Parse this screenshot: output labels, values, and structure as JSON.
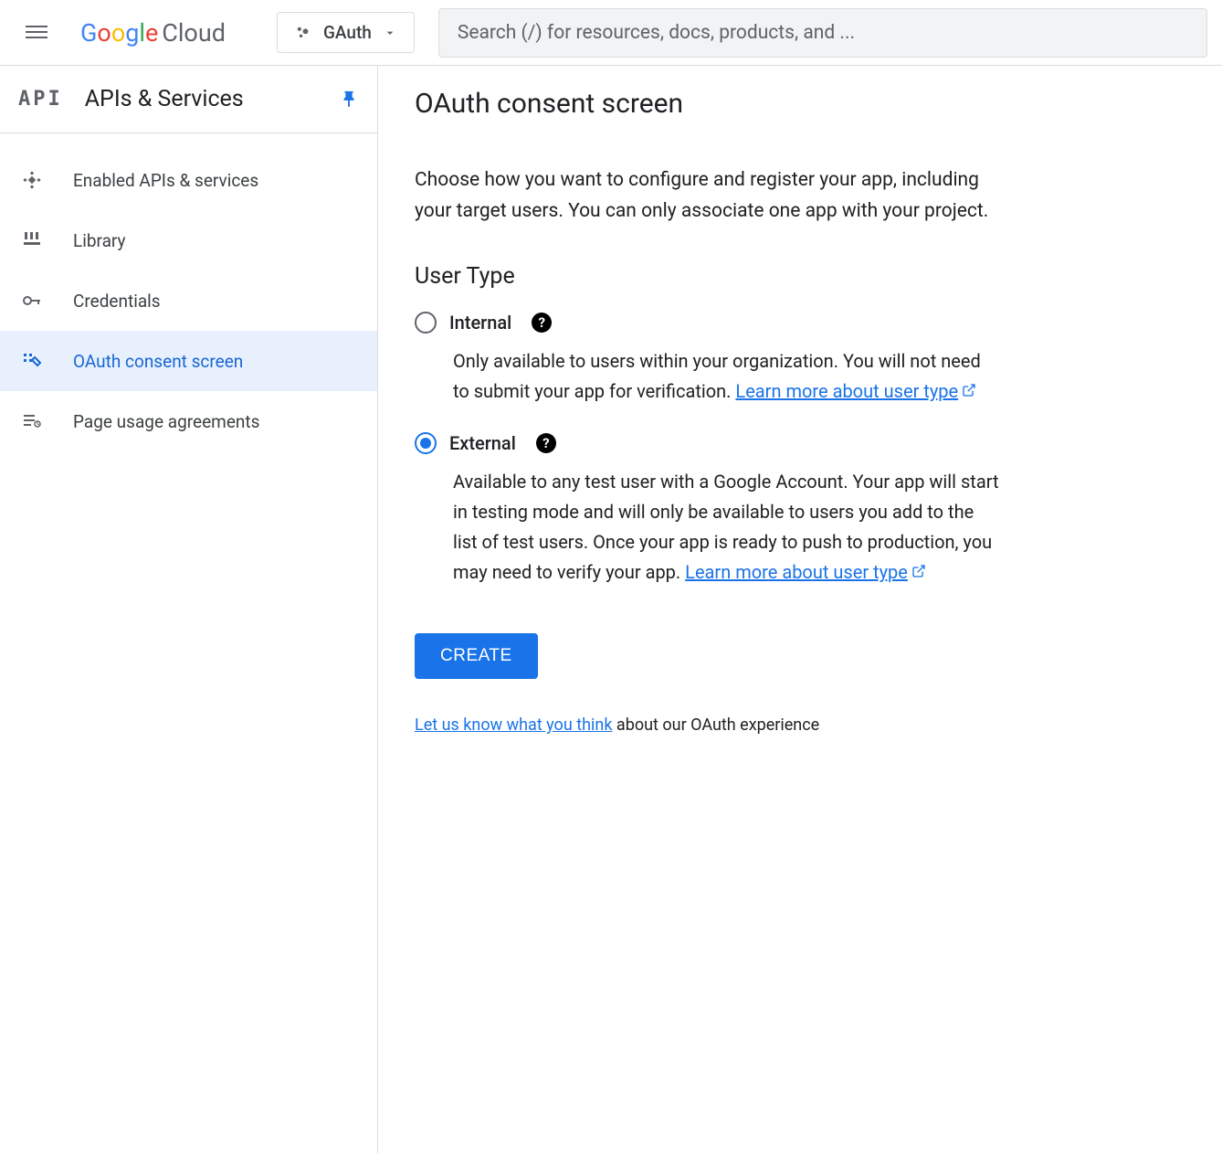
{
  "header": {
    "logo_google": "Google",
    "logo_cloud": "Cloud",
    "project_name": "GAuth",
    "search_placeholder": "Search (/) for resources, docs, products, and ..."
  },
  "sidebar": {
    "badge": "API",
    "title": "APIs & Services",
    "items": [
      {
        "label": "Enabled APIs & services",
        "icon": "diamond-dots-icon",
        "active": false
      },
      {
        "label": "Library",
        "icon": "library-icon",
        "active": false
      },
      {
        "label": "Credentials",
        "icon": "key-icon",
        "active": false
      },
      {
        "label": "OAuth consent screen",
        "icon": "consent-icon",
        "active": true
      },
      {
        "label": "Page usage agreements",
        "icon": "agreements-icon",
        "active": false
      }
    ]
  },
  "main": {
    "title": "OAuth consent screen",
    "intro": "Choose how you want to configure and register your app, including your target users. You can only associate one app with your project.",
    "user_type_header": "User Type",
    "internal": {
      "label": "Internal",
      "desc": "Only available to users within your organization. You will not need to submit your app for verification.",
      "link": "Learn more about user type"
    },
    "external": {
      "label": "External",
      "desc": "Available to any test user with a Google Account. Your app will start in testing mode and will only be available to users you add to the list of test users. Once your app is ready to push to production, you may need to verify your app.",
      "link": "Learn more about user type"
    },
    "create_button": "CREATE",
    "feedback_link": "Let us know what you think",
    "feedback_suffix": " about our OAuth experience"
  }
}
